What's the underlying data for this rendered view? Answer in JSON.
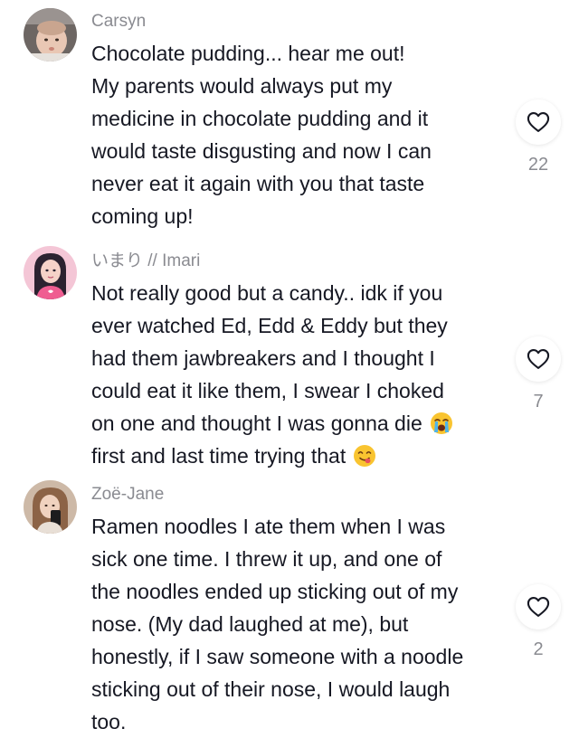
{
  "comments": [
    {
      "username": "Carsyn",
      "lines": [
        "Chocolate pudding... hear me out!",
        "My parents would always put my",
        "medicine in chocolate pudding and it",
        "would taste disgusting and now I can",
        "never eat it again with you that taste",
        "coming up!"
      ],
      "likes": "22"
    },
    {
      "username": "いまり // Imari",
      "lines": [
        "Not really good but a candy.. idk if you",
        "ever watched Ed, Edd & Eddy but they",
        "had them jawbreakers and I thought I",
        "could eat it like them, I swear I choked",
        "on one and thought I was gonna die",
        "first and last time trying that"
      ],
      "emojis": [
        "loudly-crying-face",
        "face-savoring-food"
      ],
      "likes": "7"
    },
    {
      "username": "Zoë-Jane",
      "lines": [
        "Ramen noodles I ate them when I was",
        "sick one time. I threw it up, and one of",
        "the noodles ended up sticking out of my",
        "nose. (My dad laughed at me), but",
        "honestly, if I saw someone with a noodle",
        "sticking out of their nose, I would laugh",
        "too."
      ],
      "likes": "2"
    }
  ],
  "colors": {
    "text": "#161823",
    "muted": "#8a8b91",
    "heart": "#161823"
  },
  "icons": {
    "like": "heart-outline-icon"
  }
}
